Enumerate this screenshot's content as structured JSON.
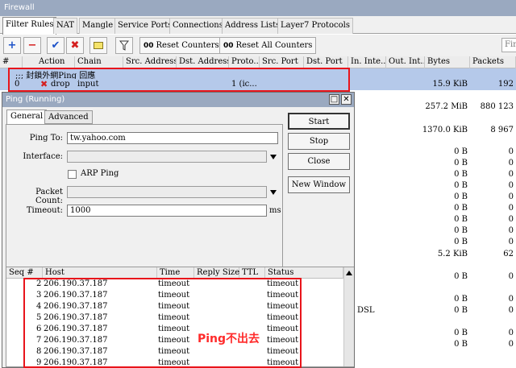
{
  "window": {
    "title": "Firewall"
  },
  "tabs": [
    "Filter Rules",
    "NAT",
    "Mangle",
    "Service Ports",
    "Connections",
    "Address Lists",
    "Layer7 Protocols"
  ],
  "toolbar": {
    "reset_counters": "Reset Counters",
    "reset_all_counters": "Reset All Counters",
    "counter_glyph": "00",
    "find_placeholder": "Fir"
  },
  "columns": [
    "#",
    "Action",
    "Chain",
    "Src. Address",
    "Dst. Address",
    "Proto...",
    "Src. Port",
    "Dst. Port",
    "In. Inte...",
    "Out. Int...",
    "Bytes",
    "Packets"
  ],
  "rule": {
    "comment": ";;; 封鎖外網Ping 回應",
    "num": "0",
    "action": "drop",
    "chain": "input",
    "proto": "1 (ic...",
    "bytes": "15.9 KiB",
    "packets": "192"
  },
  "background_rows": [
    {
      "bytes": "257.2 MiB",
      "packets": "880 123"
    },
    {
      "bytes": "1370.0 KiB",
      "packets": "8 967"
    },
    {
      "bytes": "0 B",
      "packets": "0"
    },
    {
      "bytes": "0 B",
      "packets": "0"
    },
    {
      "bytes": "0 B",
      "packets": "0"
    },
    {
      "bytes": "0 B",
      "packets": "0"
    },
    {
      "bytes": "0 B",
      "packets": "0"
    },
    {
      "bytes": "0 B",
      "packets": "0"
    },
    {
      "bytes": "0 B",
      "packets": "0"
    },
    {
      "bytes": "0 B",
      "packets": "0"
    },
    {
      "bytes": "0 B",
      "packets": "0"
    },
    {
      "bytes": "5.2 KiB",
      "packets": "62"
    },
    {
      "bytes": "0 B",
      "packets": "0"
    },
    {
      "bytes": "0 B",
      "packets": "0"
    },
    {
      "bytes": "0 B",
      "packets": "0"
    },
    {
      "bytes": "0 B",
      "packets": "0"
    },
    {
      "bytes": "0 B",
      "packets": "0"
    }
  ],
  "background_text": {
    "dsl": "DSL"
  },
  "ping": {
    "title": "Ping (Running)",
    "tabs": [
      "General",
      "Advanced"
    ],
    "ping_to_label": "Ping To:",
    "ping_to_value": "tw.yahoo.com",
    "interface_label": "Interface:",
    "arp_label": "ARP Ping",
    "packet_count_label": "Packet Count:",
    "timeout_label": "Timeout:",
    "timeout_value": "1000",
    "timeout_unit": "ms",
    "buttons": [
      "Start",
      "Stop",
      "Close",
      "New Window"
    ],
    "result_columns": [
      "Seq #",
      "Host",
      "Time",
      "Reply Size",
      "TTL",
      "Status"
    ],
    "results": [
      {
        "seq": "2",
        "host": "206.190.37.187",
        "time": "timeout",
        "status": "timeout"
      },
      {
        "seq": "3",
        "host": "206.190.37.187",
        "time": "timeout",
        "status": "timeout"
      },
      {
        "seq": "4",
        "host": "206.190.37.187",
        "time": "timeout",
        "status": "timeout"
      },
      {
        "seq": "5",
        "host": "206.190.37.187",
        "time": "timeout",
        "status": "timeout"
      },
      {
        "seq": "6",
        "host": "206.190.37.187",
        "time": "timeout",
        "status": "timeout"
      },
      {
        "seq": "7",
        "host": "206.190.37.187",
        "time": "timeout",
        "status": "timeout"
      },
      {
        "seq": "8",
        "host": "206.190.37.187",
        "time": "timeout",
        "status": "timeout"
      },
      {
        "seq": "9",
        "host": "206.190.37.187",
        "time": "timeout",
        "status": "timeout"
      }
    ]
  },
  "annotation": "Ping不出去",
  "colors": {
    "title_bar": "#9aa9c0",
    "selection": "#b5c9ea",
    "highlight_box": "#e8141b",
    "annotation": "#ff2a2a"
  }
}
